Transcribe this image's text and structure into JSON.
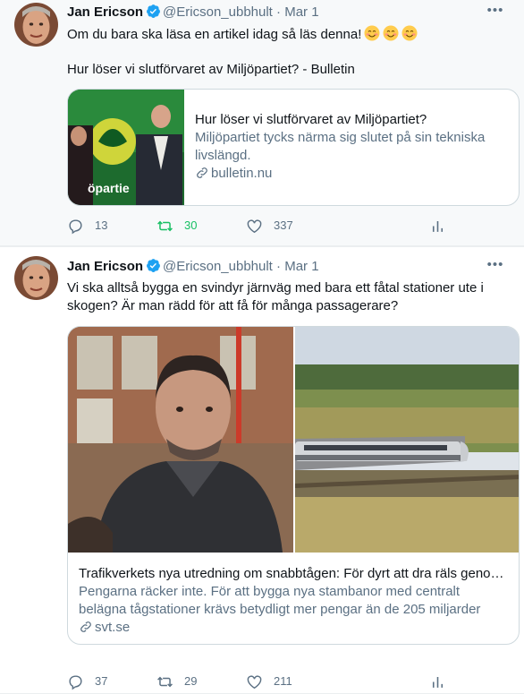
{
  "tweets": [
    {
      "author_name": "Jan Ericson",
      "handle": "@Ericson_ubbhult",
      "separator": "·",
      "date": "Mar 1",
      "text_line1": "Om du bara ska läsa en artikel idag så läs denna!",
      "emoji": [
        "smiling-face-icon",
        "smiling-face-icon",
        "smiling-face-icon"
      ],
      "text_line2": "Hur löser vi slutförvaret av Miljöpartiet? - Bulletin",
      "card": {
        "title": "Hur löser vi slutförvaret av Miljöpartiet?",
        "description": "Miljöpartiet tycks närma sig slutet på sin tekniska livslängd.",
        "domain": "bulletin.nu"
      },
      "stats": {
        "replies": "13",
        "retweets": "30",
        "likes": "337"
      },
      "retweeted": true
    },
    {
      "author_name": "Jan Ericson",
      "handle": "@Ericson_ubbhult",
      "separator": "·",
      "date": "Mar 1",
      "text": "Vi ska alltså bygga en svindyr järnväg med bara ett fåtal stationer ute i skogen? Är man rädd för att få för många passagerare?",
      "card": {
        "title": "Trafikverkets nya utredning om snabbtågen: För dyrt att dra räls geno…",
        "description": "Pengarna räcker inte. För att bygga nya stambanor med centralt belägna tågstationer krävs betydligt mer pengar än de 205 miljarder som …",
        "domain": "svt.se"
      },
      "stats": {
        "replies": "37",
        "retweets": "29",
        "likes": "211"
      },
      "retweeted": false
    }
  ],
  "colors": {
    "accent": "#1da1f2",
    "secondary_text": "#5b7083",
    "retweet_green": "#17bf63",
    "border": "#cfd9de"
  }
}
